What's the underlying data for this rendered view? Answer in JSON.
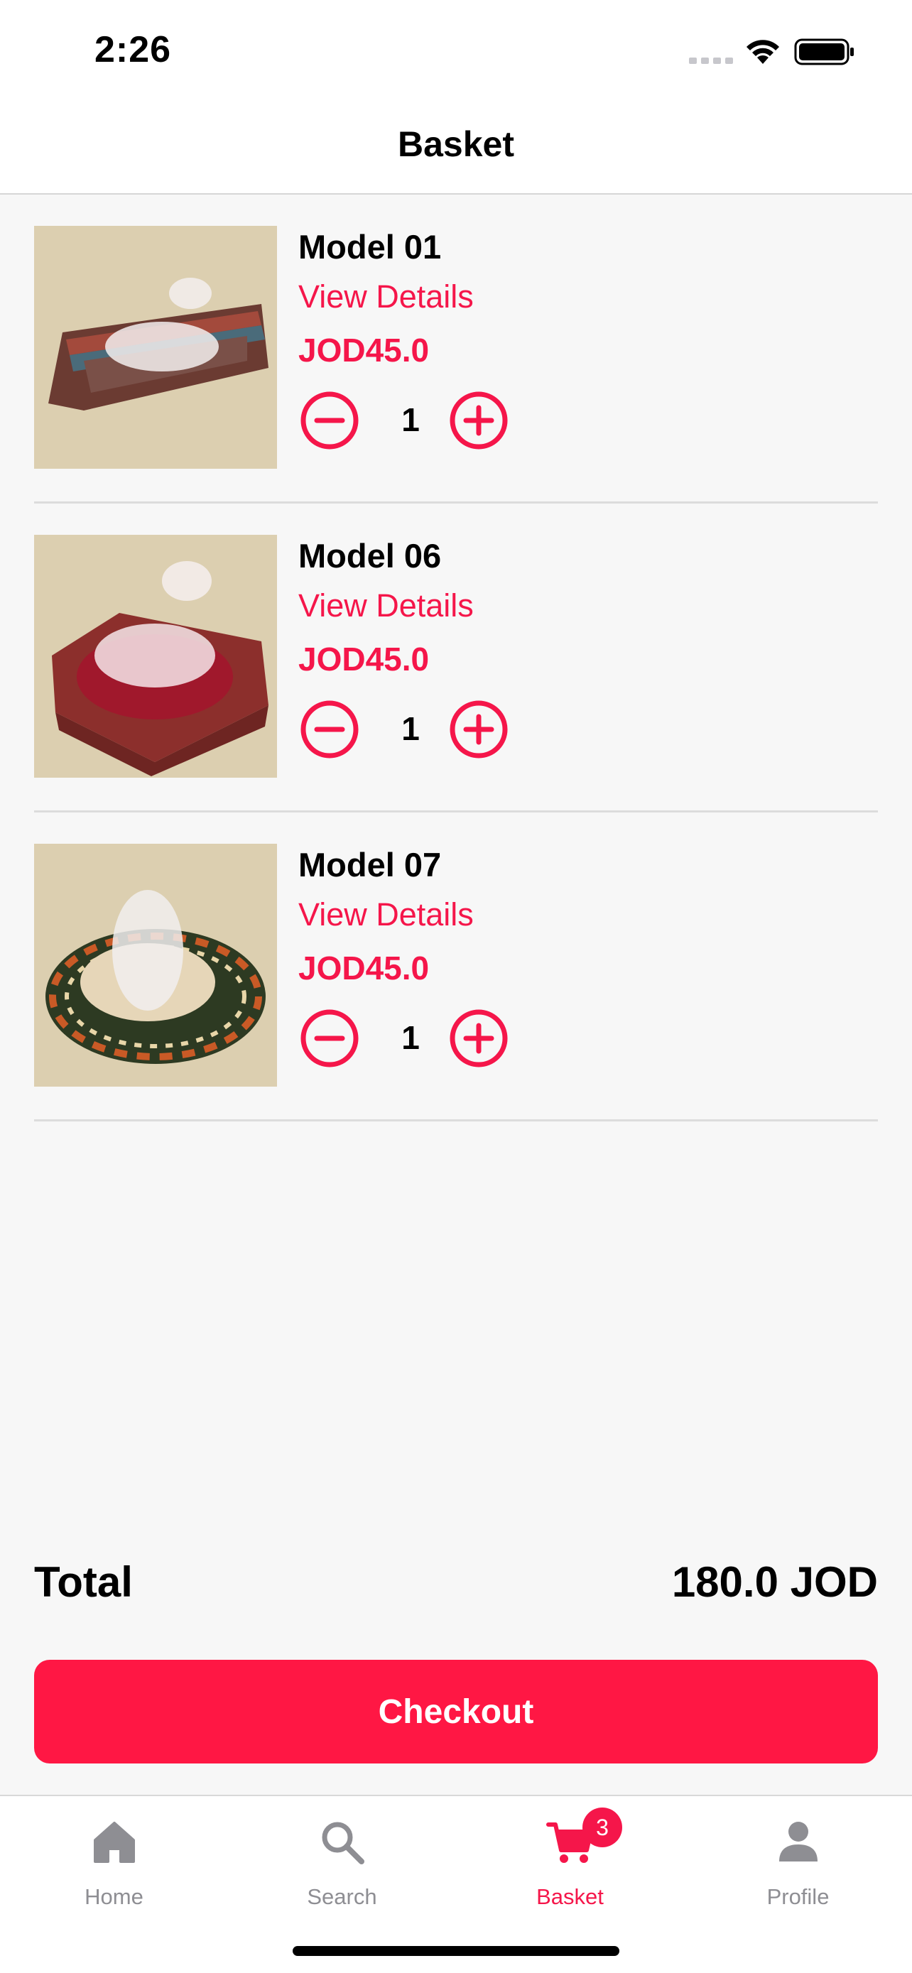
{
  "status_bar": {
    "time": "2:26",
    "icons": [
      "signal-icon",
      "wifi-icon",
      "battery-icon"
    ]
  },
  "nav": {
    "title": "Basket"
  },
  "items": [
    {
      "name": "Model 01",
      "details_label": "View Details",
      "price": "JOD45.0",
      "quantity": "1",
      "image": "pet-bed-rectangular-striped"
    },
    {
      "name": "Model 06",
      "details_label": "View Details",
      "price": "JOD45.0",
      "quantity": "1",
      "image": "pet-bed-rectangular-red"
    },
    {
      "name": "Model 07",
      "details_label": "View Details",
      "price": "JOD45.0",
      "quantity": "1",
      "image": "pet-bed-round-patterned"
    }
  ],
  "summary": {
    "total_label": "Total",
    "total_value": "180.0 JOD",
    "checkout_label": "Checkout"
  },
  "tabs": [
    {
      "label": "Home",
      "icon": "home-icon",
      "active": false
    },
    {
      "label": "Search",
      "icon": "search-icon",
      "active": false
    },
    {
      "label": "Basket",
      "icon": "cart-icon",
      "active": true,
      "badge": "3"
    },
    {
      "label": "Profile",
      "icon": "profile-icon",
      "active": false
    }
  ],
  "colors": {
    "accent": "#f5164a",
    "checkout": "#ff1744",
    "background": "#f7f7f7",
    "image_background": "#dccfb0",
    "inactive_tab": "#8e8e93"
  }
}
